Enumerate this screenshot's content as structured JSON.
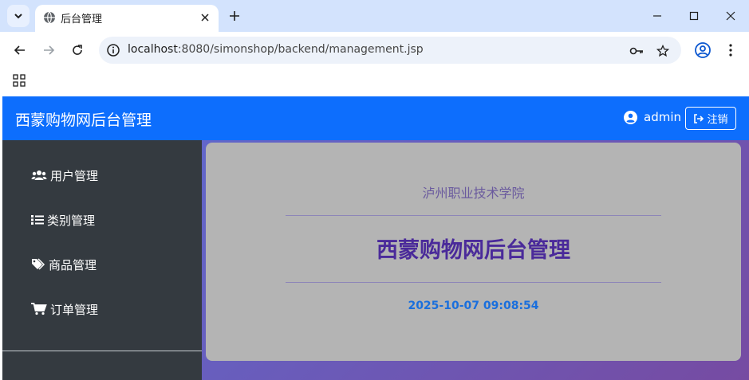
{
  "browser": {
    "tab_title": "后台管理",
    "url_host": "localhost",
    "url_rest": ":8080/simonshop/backend/management.jsp"
  },
  "navbar": {
    "brand": "西蒙购物网后台管理",
    "username": "admin",
    "logout_label": "注销"
  },
  "sidebar": {
    "items": [
      {
        "label": "用户管理",
        "icon": "users-icon"
      },
      {
        "label": "类别管理",
        "icon": "list-icon"
      },
      {
        "label": "商品管理",
        "icon": "tags-icon"
      },
      {
        "label": "订单管理",
        "icon": "cart-icon"
      }
    ]
  },
  "main": {
    "school": "泸州职业技术学院",
    "title": "西蒙购物网后台管理",
    "datetime": "2025-10-07 09:08:54"
  },
  "colors": {
    "navbar": "#0d6efd",
    "sidebar": "#343a40",
    "gradient_start": "#5b6fd6",
    "gradient_end": "#764ba2",
    "title": "#4a2a9a",
    "clock": "#1a6fdd"
  }
}
